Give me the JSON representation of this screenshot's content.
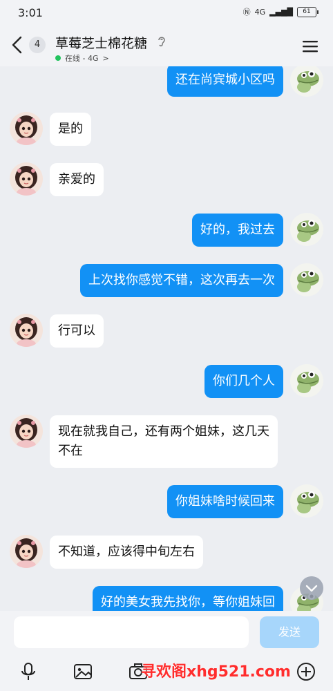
{
  "status_bar": {
    "time": "3:01",
    "network": "4G",
    "battery": "61"
  },
  "header": {
    "back_badge": "4",
    "title": "草莓芝士棉花糖",
    "status_text": "在线 - 4G",
    "status_chevron": ">"
  },
  "messages": [
    {
      "side": "out",
      "text": "还在尚宾城小区吗"
    },
    {
      "side": "in",
      "text": "是的"
    },
    {
      "side": "in",
      "text": "亲爱的"
    },
    {
      "side": "out",
      "text": "好的，我过去"
    },
    {
      "side": "out",
      "text": "上次找你感觉不错，这次再去一次"
    },
    {
      "side": "in",
      "text": "行可以"
    },
    {
      "side": "out",
      "text": "你们几个人"
    },
    {
      "side": "in",
      "text": "现在就我自己，还有两个姐妹，这几天不在"
    },
    {
      "side": "out",
      "text": "你姐妹啥时候回来"
    },
    {
      "side": "in",
      "text": "不知道，应该得中旬左右"
    },
    {
      "side": "out",
      "text": "好的美女我先找你，等你姐妹回"
    }
  ],
  "input": {
    "placeholder": "",
    "send_label": "发送"
  },
  "toolbar": [
    "mic-icon",
    "image-icon",
    "camera-icon",
    "plus-icon"
  ],
  "watermark": "寻欢阁xhg521.com",
  "colors": {
    "outgoing_bubble": "#1291f5",
    "incoming_bubble": "#ffffff",
    "background": "#eceef2",
    "send_button": "#a7d6fb",
    "online_dot": "#22c35e"
  }
}
